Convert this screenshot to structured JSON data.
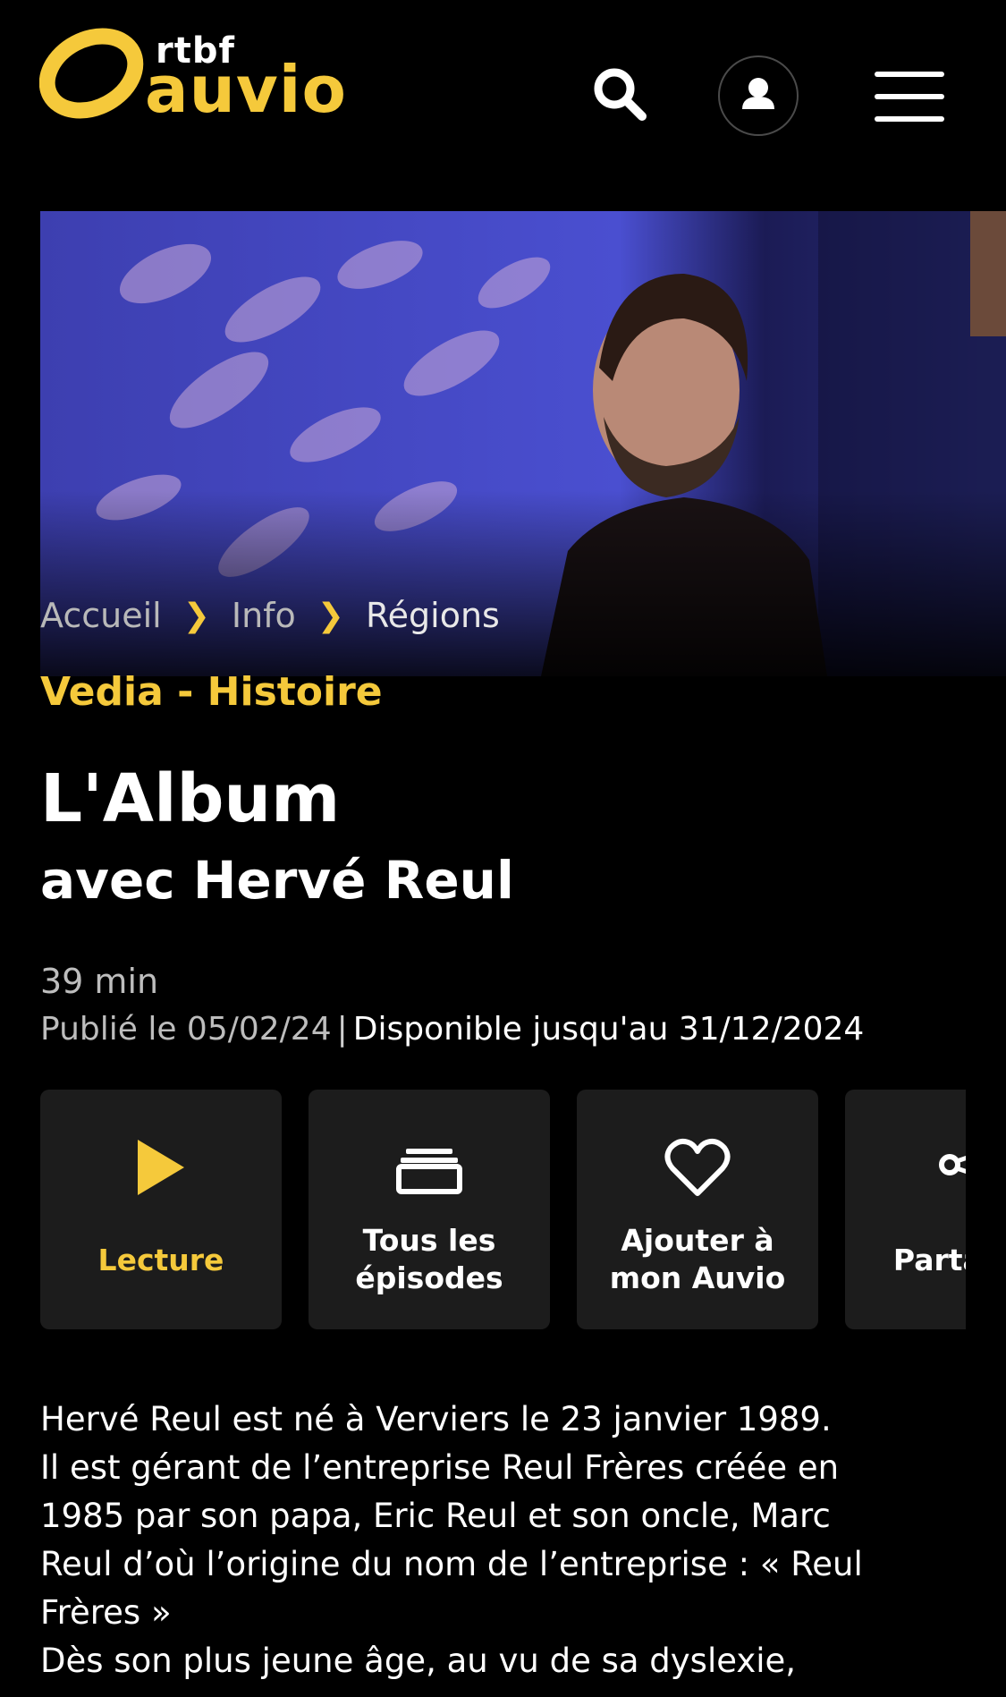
{
  "header": {
    "logo_small": "rtbf",
    "logo_main": "auvio"
  },
  "breadcrumb": [
    "Accueil",
    "Info",
    "Régions"
  ],
  "program": "Vedia - Histoire",
  "title": "L'Album",
  "subtitle": "avec Hervé Reul",
  "duration": "39 min",
  "published": "Publié le 05/02/24",
  "dates_separator": "|",
  "available": "Disponible jusqu'au 31/12/2024",
  "actions": {
    "play": "Lecture",
    "episodes_line1": "Tous les",
    "episodes_line2": "épisodes",
    "add_line1": "Ajouter à",
    "add_line2": "mon Auvio",
    "share": "Partager"
  },
  "description": [
    "Hervé Reul est né à Verviers le 23 janvier 1989.",
    "Il est gérant  de l’entreprise Reul Frères créée en",
    "1985 par son papa, Eric Reul et son oncle, Marc",
    "Reul d’où l’origine du nom de l’entreprise : « Reul",
    "Frères »",
    "Dès son plus jeune âge, au vu de sa dyslexie,"
  ],
  "colors": {
    "accent": "#f5c93b",
    "background": "#000000",
    "tile": "#1c1c1c"
  },
  "icons": [
    "search-icon",
    "user-icon",
    "menu-icon",
    "play-icon",
    "episodes-icon",
    "heart-icon",
    "share-icon",
    "chevron-right-icon"
  ]
}
